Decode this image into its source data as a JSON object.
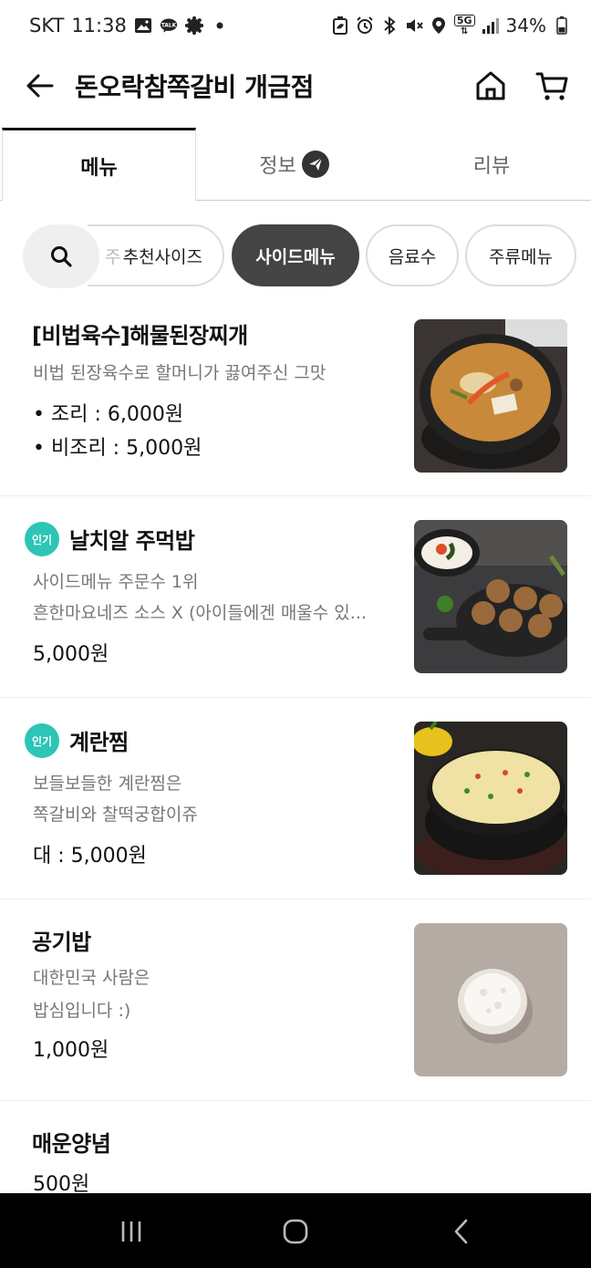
{
  "status_bar": {
    "carrier": "SKT",
    "time": "11:38",
    "network": "5G",
    "battery": "34%",
    "icons_left": [
      "gallery-icon",
      "kakaotalk-icon",
      "settings-badge-icon",
      "dot-icon"
    ],
    "icons_right": [
      "battery-saver-icon",
      "alarm-icon",
      "bluetooth-icon",
      "mute-icon",
      "location-icon",
      "network-5g-icon",
      "signal-icon",
      "battery-icon"
    ]
  },
  "header": {
    "title": "돈오락참쪽갈비 개금점"
  },
  "tabs": [
    {
      "label": "메뉴",
      "active": true
    },
    {
      "label": "정보",
      "active": false
    },
    {
      "label": "리뷰",
      "active": false
    }
  ],
  "categories": {
    "partial_prefix": "주",
    "items": [
      "추천사이즈",
      "사이드메뉴",
      "음료수",
      "주류메뉴"
    ],
    "selected": "사이드메뉴"
  },
  "menu": [
    {
      "name": "[비법육수]해물된장찌개",
      "popular": false,
      "desc": [
        "비법 된장육수로 할머니가 끓여주신 그맛"
      ],
      "prices": [
        "• 조리 : 6,000원",
        "• 비조리 : 5,000원"
      ]
    },
    {
      "name": "날치알 주먹밥",
      "popular": true,
      "badge": "인기",
      "desc": [
        "사이드메뉴 주문수 1위",
        "흔한마요네즈 소스 X (아이들에겐 매울수 있..."
      ],
      "prices": [
        "5,000원"
      ]
    },
    {
      "name": "계란찜",
      "popular": true,
      "badge": "인기",
      "desc": [
        "보들보들한 계란찜은",
        "쪽갈비와 찰떡궁합이쥬"
      ],
      "prices": [
        "대 : 5,000원"
      ]
    },
    {
      "name": "공기밥",
      "popular": false,
      "desc": [
        "대한민국 사람은",
        "밥심입니다 :)"
      ],
      "prices": [
        "1,000원"
      ]
    },
    {
      "name": "매운양념",
      "popular": false,
      "desc": [],
      "prices": [
        "500원"
      ]
    }
  ],
  "colors": {
    "popular_badge": "#2cc5b6",
    "active_chip": "#444444",
    "nav_bar": "#000000"
  }
}
